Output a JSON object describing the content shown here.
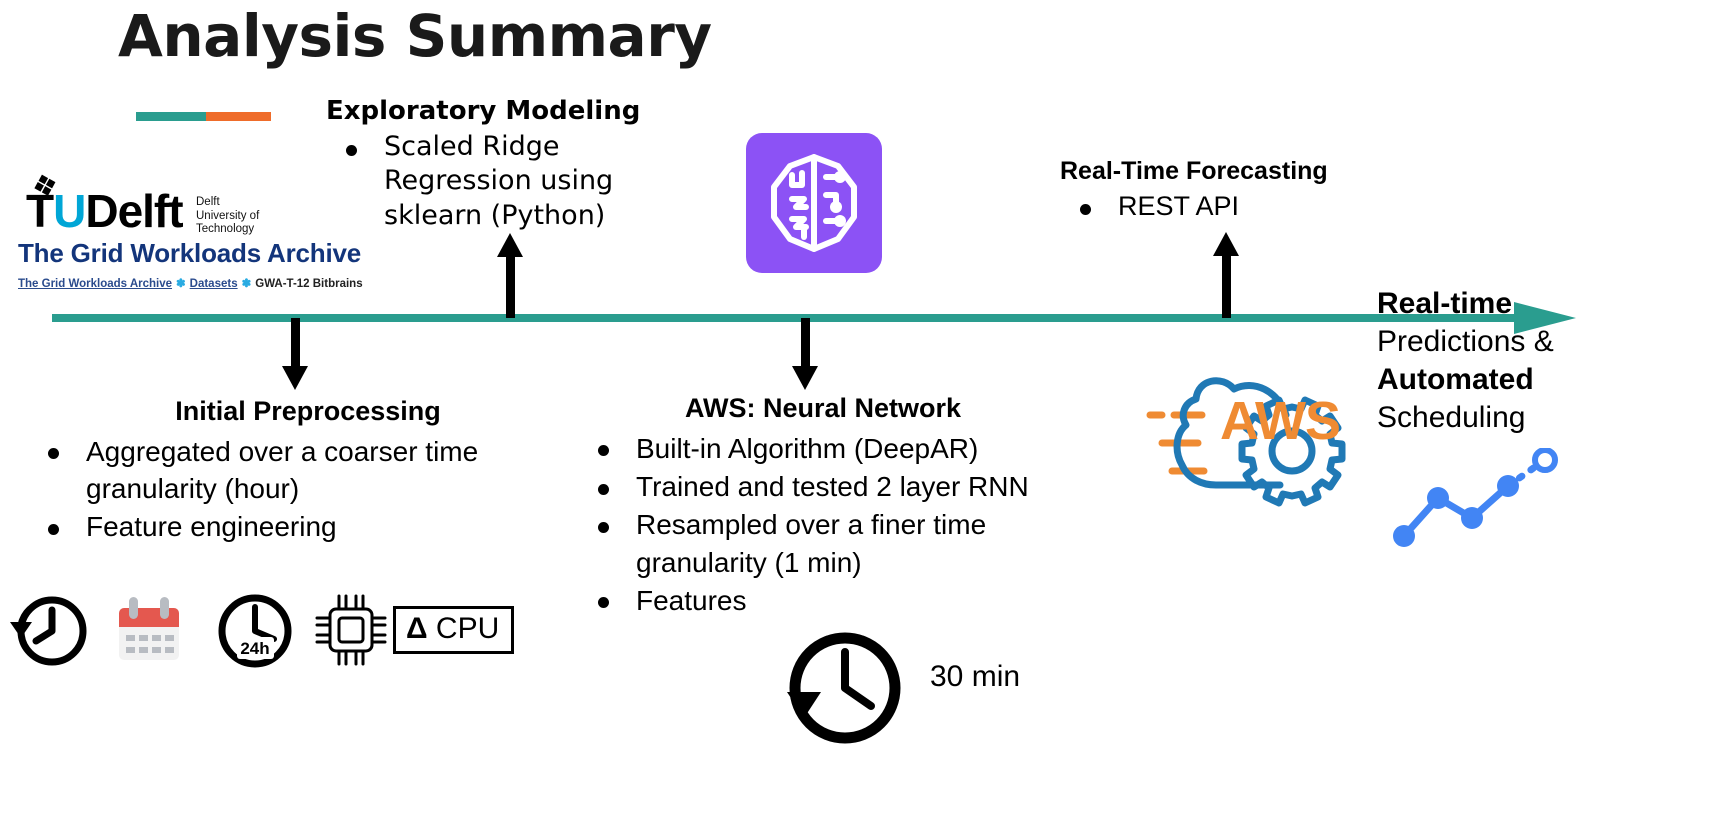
{
  "title": "Analysis Summary",
  "accent": {
    "teal": "#2a9d8f",
    "orange": "#ef6c2a"
  },
  "logo": {
    "flame_icon": "tudelft-flame-icon",
    "tu": "TU",
    "u": "U",
    "delft": "Delft",
    "subtitle_line1": "Delft",
    "subtitle_line2": "University of",
    "subtitle_line3": "Technology",
    "archive_title": "The Grid Workloads Archive",
    "crumb1": "The Grid Workloads Archive",
    "crumb2": "Datasets",
    "crumb3": "GWA-T-12 Bitbrains",
    "crumb_separator": "✽",
    "archive_color": "#13357b",
    "link_color": "#2a4b8d",
    "accent_blue": "#00A6D6"
  },
  "exploratory": {
    "heading": "Exploratory Modeling",
    "bullets": [
      "Scaled Ridge Regression using sklearn (Python)"
    ]
  },
  "forecasting": {
    "heading": "Real-Time Forecasting",
    "bullets": [
      "REST API"
    ]
  },
  "preprocessing": {
    "heading": "Initial Preprocessing",
    "bullets": [
      "Aggregated over a coarser time granularity (hour)",
      "Feature engineering"
    ]
  },
  "neural_network": {
    "heading": "AWS: Neural Network",
    "bullets": [
      "Built-in Algorithm (DeepAR)",
      "Trained and tested 2 layer RNN",
      "Resampled over a finer time granularity (1 min)",
      "Features"
    ]
  },
  "outcome": {
    "line1": "Real-time",
    "line2": "Predictions &",
    "line3": "Automated",
    "line4": "Scheduling"
  },
  "sagemaker": {
    "icon": "brain-circuit-icon",
    "tile_color": "#8c52f5"
  },
  "aws_logo": {
    "wordmark": "AWS",
    "cloud_color": "#2079b5",
    "text_color": "#ef8b33",
    "gear_icon": "gear-icon",
    "cloud_icon": "cloud-icon"
  },
  "sparkline": {
    "icon": "line-chart-icon",
    "color": "#4285f4"
  },
  "icons": [
    {
      "name": "clock-rewind-icon",
      "label": ""
    },
    {
      "name": "calendar-icon",
      "label": ""
    },
    {
      "name": "clock-24h-icon",
      "label": "24h"
    },
    {
      "name": "cpu-chip-icon",
      "label": ""
    }
  ],
  "cpu_box": {
    "delta": "Δ",
    "label": "CPU"
  },
  "clock30": {
    "icon": "clock-icon",
    "label": "30 min"
  }
}
